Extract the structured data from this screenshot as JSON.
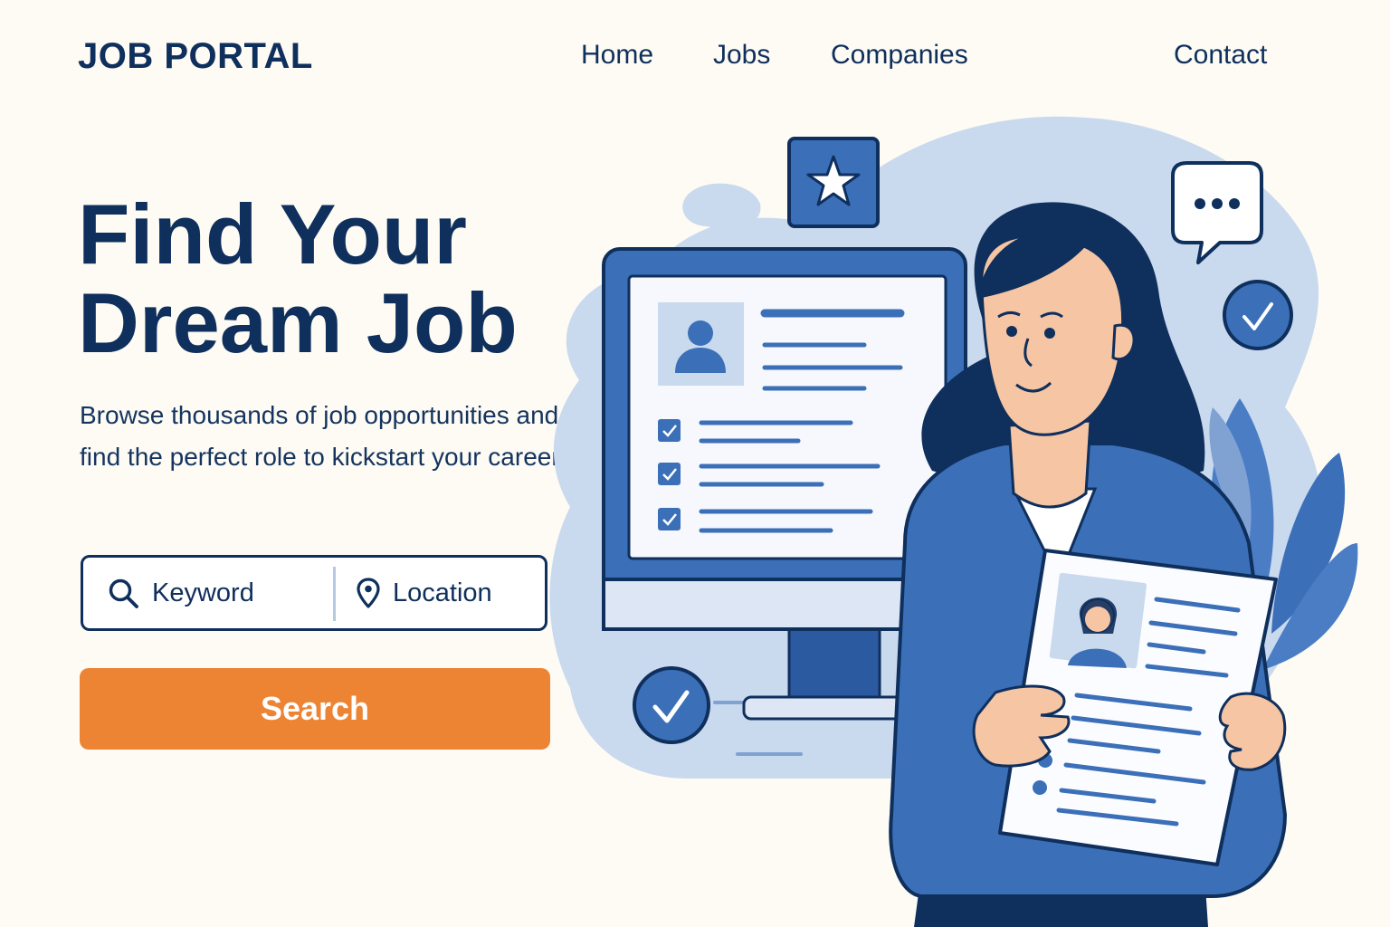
{
  "header": {
    "logo": "JOB PORTAL",
    "nav": [
      {
        "label": "Home"
      },
      {
        "label": "Jobs"
      },
      {
        "label": "Companies"
      },
      {
        "label": "Contact"
      }
    ]
  },
  "hero": {
    "title_line1": "Find Your",
    "title_line2": "Dream Job",
    "subtitle": "Browse thousands of job opportunities and find the perfect role to kickstart your career."
  },
  "search": {
    "keyword_placeholder": "Keyword",
    "location_placeholder": "Location",
    "button_label": "Search"
  },
  "colors": {
    "navy": "#0f2f5c",
    "accent_orange": "#ec8434",
    "blue": "#3b6fb8",
    "light_blue": "#c9d9ee",
    "background": "#fdfbf4"
  },
  "icons": [
    "search-icon",
    "location-pin-icon",
    "star-icon",
    "chat-bubble-icon",
    "checkmark-icon",
    "user-icon"
  ]
}
